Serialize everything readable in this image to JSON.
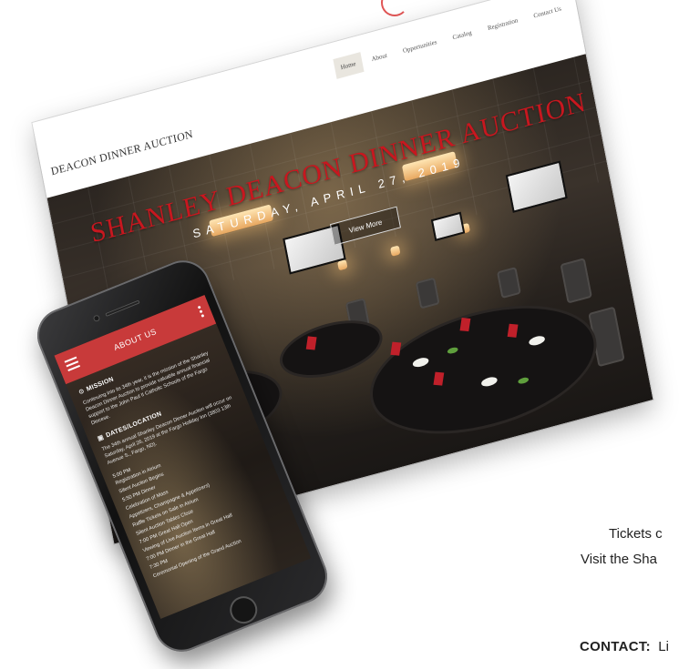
{
  "site": {
    "logo": "DEACON DINNER AUCTION",
    "nav": [
      "Home",
      "About",
      "Opportunities",
      "Catalog",
      "Registration",
      "Contact Us"
    ],
    "active_nav": "Home",
    "hero_title": "Shanley Deacon Dinner Auction",
    "hero_date": "SATURDAY, APRIL 27, 2019",
    "hero_button": "View More"
  },
  "phone": {
    "app_title": "ABOUT US",
    "mission_heading": "MISSION",
    "mission_text": "Continuing into its 34th year, it is the mission of the Shanley Deacon Dinner Auction to provide valuable annual financial support to the John Paul II Catholic Schools of the Fargo Diocese.",
    "dates_heading": "DATES/LOCATION",
    "dates_text": "The 34th annual Shanley Deacon Dinner Auction will occur on Saturday, April 26, 2019 at the Fargo Holiday Inn (3803 13th Avenue S., Fargo, ND).",
    "schedule": [
      {
        "time": "5:00 PM",
        "text": "Registration in Atrium"
      },
      {
        "time": "",
        "text": "Silent Auction Begins"
      },
      {
        "time": "5:50 PM",
        "text": "Dinner"
      },
      {
        "time": "",
        "text": "Celebration of Mass"
      },
      {
        "time": "",
        "text": "Appetizers, Champagne & Appetizers)"
      },
      {
        "time": "",
        "text": "Raffle Tickets on Sale in Atrium"
      },
      {
        "time": "",
        "text": "Silent Auction Tables Close"
      },
      {
        "time": "7:00 PM",
        "text": "Great Hall Open"
      },
      {
        "time": "",
        "text": "Viewing of Live Auction Items in Great Hall"
      },
      {
        "time": "7:00 PM",
        "text": "Dinner in the Great Hall"
      },
      {
        "time": "7:30 PM",
        "text": ""
      },
      {
        "time": "",
        "text": "Ceremonial Opening of the Grand Auction"
      }
    ]
  },
  "page": {
    "tickets_text": "Tickets c",
    "visit_text": "Visit the Sha",
    "contact_label": "CONTACT:",
    "contact_value": "Li"
  },
  "colors": {
    "brand_red": "#c8171f",
    "app_bar_red": "#c83a3a",
    "nav_active_bg": "#e9e6df"
  }
}
